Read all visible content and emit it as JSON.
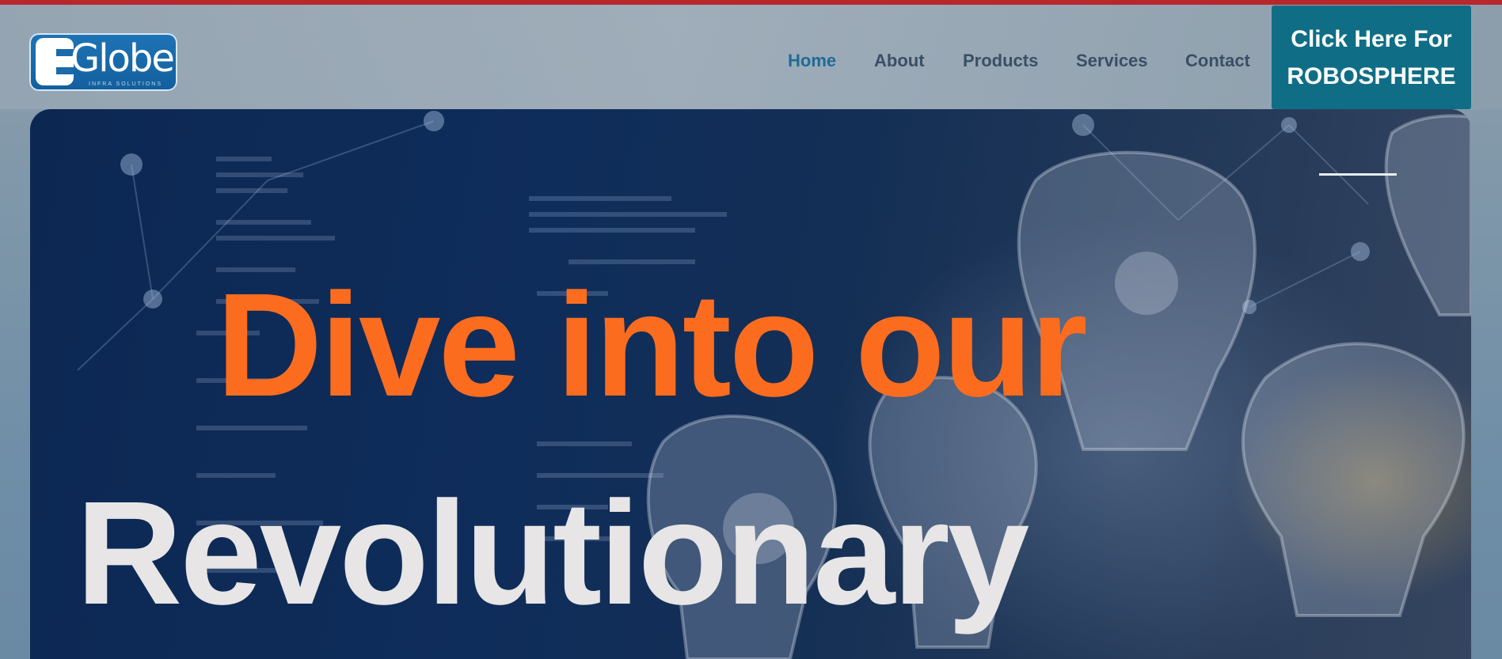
{
  "logo": {
    "text": "Globe",
    "subtext": "INFRA SOLUTIONS"
  },
  "nav": {
    "items": [
      {
        "label": "Home",
        "active": true
      },
      {
        "label": "About",
        "active": false
      },
      {
        "label": "Products",
        "active": false
      },
      {
        "label": "Services",
        "active": false
      },
      {
        "label": "Contact",
        "active": false
      }
    ]
  },
  "cta": {
    "label": "Click Here For\nROBOSPHERE"
  },
  "hero": {
    "headline_line1": "Dive into our",
    "headline_line2": "Revolutionary"
  },
  "colors": {
    "top_bar": "#b8272b",
    "nav_text": "#3a4f66",
    "nav_active": "#1f6b98",
    "cta_bg": "#0f6e85",
    "headline_orange": "#fc6c1f",
    "headline_white": "#e7e5e5",
    "hero_bg": "#0f2d5b"
  }
}
